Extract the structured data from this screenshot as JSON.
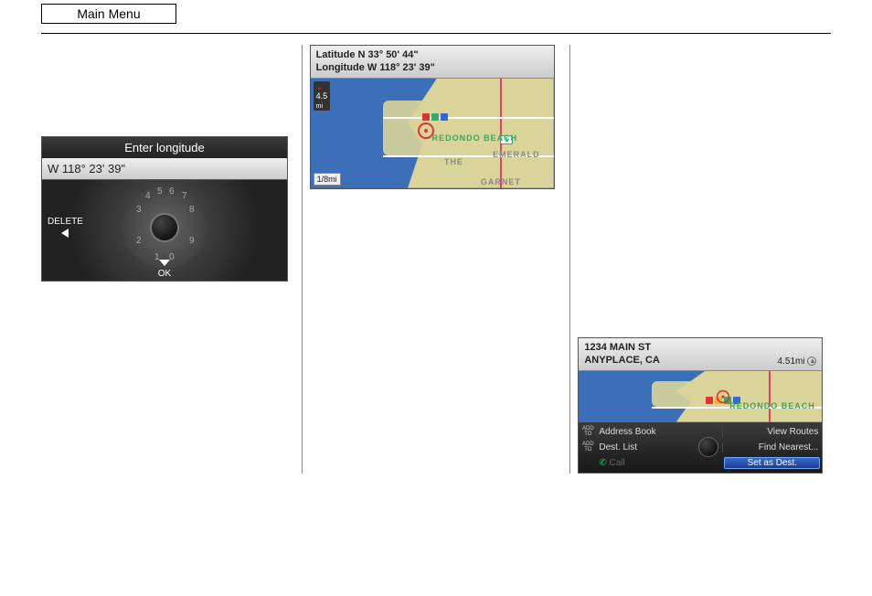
{
  "header": {
    "main_menu": "Main Menu"
  },
  "screen1": {
    "title": "Enter longitude",
    "value": "W 118° 23' 39\"",
    "delete": "DELETE",
    "ok": "OK",
    "dial_numbers": [
      "5",
      "6",
      "4",
      "7",
      "3",
      "8",
      "2",
      "9",
      "1",
      "0"
    ]
  },
  "screen2": {
    "lat_label": "Latitude N 33° 50' 44\"",
    "lon_label": "Longitude W 118° 23' 39\"",
    "dist": "4.5",
    "dist_unit": "mi",
    "scale": "1/8mi",
    "place_label": "REDONDO BEACH",
    "hwy": "1",
    "road_labels": [
      "THE",
      "EMERALD",
      "GARNET"
    ]
  },
  "screen3": {
    "address_line1": "1234 MAIN ST",
    "address_line2": "ANYPLACE, CA",
    "distance": "4.51mi",
    "place_label": "REDONDO BEACH",
    "menu": {
      "add_to": "ADD TO",
      "address_book": "Address Book",
      "dest_list": "Dest. List",
      "call": "Call",
      "view_routes": "View Routes",
      "find_nearest": "Find Nearest...",
      "set_as_dest": "Set as Dest."
    }
  }
}
